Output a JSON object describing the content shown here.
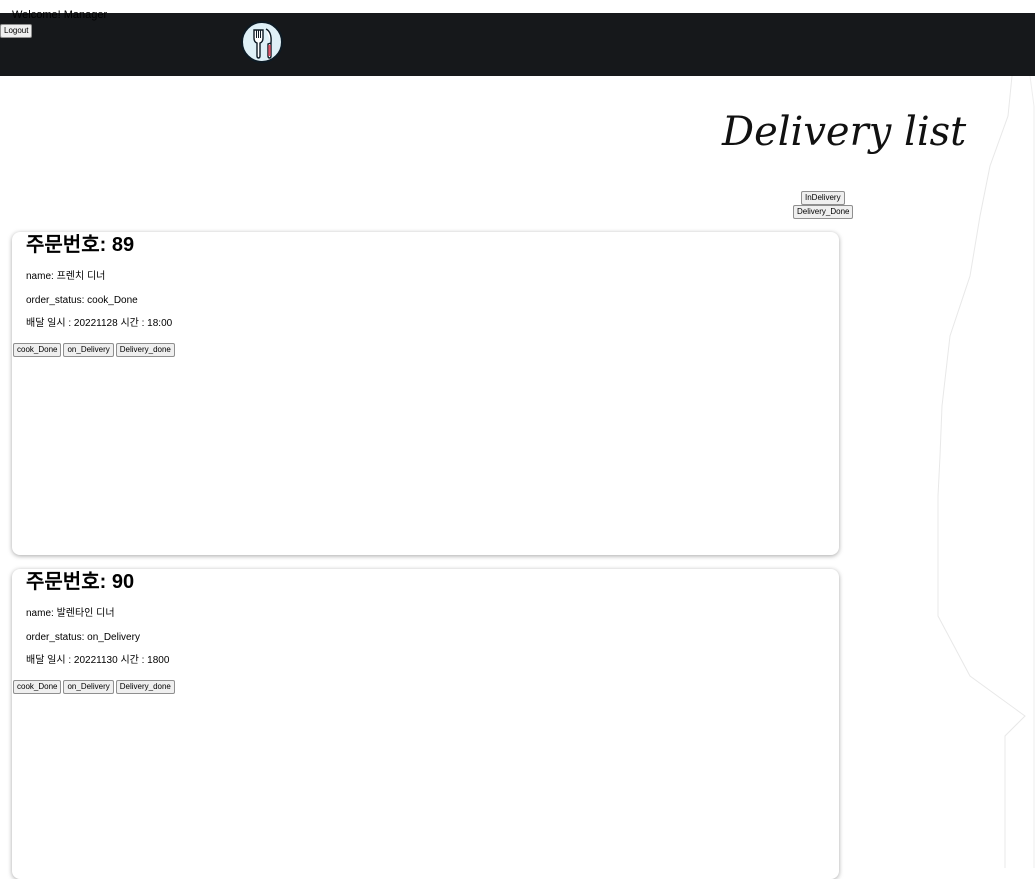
{
  "header": {
    "welcome_text": "Welcome! Manager",
    "logout_label": "Logout",
    "logo_icon": "fork-knife-plate-logo"
  },
  "page": {
    "title": "Delivery list",
    "filters": {
      "in_delivery_label": "InDelivery",
      "delivery_done_label": "Delivery_Done"
    }
  },
  "orders": [
    {
      "title": "주문번호: 89",
      "name_line": "name: 프렌치 디너",
      "status_line": "order_status: cook_Done",
      "date_line": "배달 일시 : 20221128 시간 : 18:00",
      "buttons": [
        "cook_Done",
        "on_Delivery",
        "Delivery_done"
      ]
    },
    {
      "title": "주문번호: 90",
      "name_line": "name: 발렌타인 디너",
      "status_line": "order_status: on_Delivery",
      "date_line": "배달 일시 : 20221130 시간 : 1800",
      "buttons": [
        "cook_Done",
        "on_Delivery",
        "Delivery_done"
      ]
    }
  ],
  "colors": {
    "header_bg": "#16181b",
    "logo_bg": "#dff0f7",
    "knife_accent": "#e0566a"
  }
}
